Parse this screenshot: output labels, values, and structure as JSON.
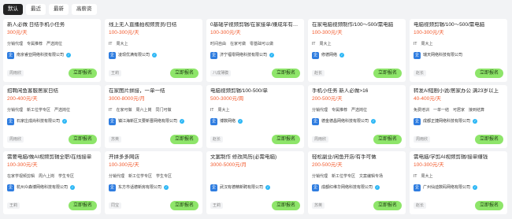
{
  "tabs": [
    "默认",
    "最近",
    "最新",
    "高薪资"
  ],
  "active_tab": 0,
  "apply_label": "立即报名",
  "cards": [
    {
      "title": "新人必做 日结手机小任务",
      "salary": "300元/天",
      "tags": [
        "分销代理",
        "专属推荐",
        "严选岗位"
      ],
      "company": "南京睿亚网络科技有限公司",
      "verified": true,
      "recruiter": "周雨欣"
    },
    {
      "title": "线上无人直播拍视频贾员/日结",
      "salary": "100-300元/天",
      "tags": [
        "IT",
        "周大上"
      ],
      "company": "凌现优满有限公司",
      "verified": true,
      "recruiter": "王莉"
    },
    {
      "title": "0基础学视频剪辑/在家接单/赚成年有电脑",
      "salary": "100-300元/天",
      "tags": [
        "时间自由",
        "在家可做",
        "零基础可以做"
      ],
      "company": "济宁福零网络科技有限公司",
      "verified": true,
      "recruiter": "八成薄膜"
    },
    {
      "title": "在家电脑视频制作/100～500/需电脑",
      "salary": "100-300元/天",
      "tags": [
        "IT",
        "周大上"
      ],
      "company": "修德网络",
      "verified": true,
      "recruiter": "赵长"
    },
    {
      "title": "电脑视频剪辑/100～500/需电脑",
      "salary": "100-300元/天",
      "tags": [
        "IT",
        "周大上"
      ],
      "company": "瑞天网络科技有限公司",
      "verified": false,
      "recruiter": "赵长"
    },
    {
      "title": "招聘闲鱼客服居家日结",
      "salary": "200-400元/天",
      "tags": [
        "分销代理",
        "新工位学专区",
        "严选岗位"
      ],
      "company": "石家庄成尚科技有限公司",
      "verified": true,
      "recruiter": "周雨欣"
    },
    {
      "title": "在家图片拼接，一单一结",
      "salary": "3000-8000元/月",
      "tags": [
        "IT",
        "在家可做",
        "周六上岗",
        "同门可做"
      ],
      "company": "镇江海新区又要新晋网络有限公司",
      "verified": true,
      "recruiter": "苏英"
    },
    {
      "title": "电脑视频剪辑/100-500/单",
      "salary": "500-3000元/周",
      "tags": [
        "IT",
        "周大上"
      ],
      "company": "博数网络",
      "verified": true,
      "recruiter": "赵长"
    },
    {
      "title": "手机小任务 新人必做>16",
      "salary": "200-500元/天",
      "tags": [
        "分销代理",
        "专属推荐",
        "严选岗位"
      ],
      "company": "德金德昌网络科技有限公司",
      "verified": true,
      "recruiter": "周雨欣"
    },
    {
      "title": "转发AI短剧小说/居家办公 满23岁以上",
      "salary": "40-400元/天",
      "tags": [
        "免费培训",
        "一单一结",
        "可居家",
        "接到结算"
      ],
      "company": "成都正捷网络科技有限公司",
      "verified": true,
      "recruiter": "周雨欣"
    },
    {
      "title": "需要电脑/做AI视频剪辑全职/在线接单",
      "salary": "100-300元/天",
      "tags": [
        "在家学视频剪辑",
        "周六上岗",
        "学生专区"
      ],
      "company": "杭州众森博网络科技有限公司",
      "verified": true,
      "recruiter": "王莉"
    },
    {
      "title": "开拼多多网店",
      "salary": "100-300元/天",
      "tags": [
        "分销代理",
        "新工位学专区",
        "学生专区"
      ],
      "company": "东方市话德新房有限公司",
      "verified": true,
      "recruiter": "同宝"
    },
    {
      "title": "文案制作 修改简历(必需电脑)",
      "salary": "3000-5000元/月",
      "tags": [],
      "company": "武汉有德精新聘有限公司",
      "verified": true,
      "recruiter": "王莉"
    },
    {
      "title": "轻松副业/闲鱼开店/有手可做",
      "salary": "200-500元/天",
      "tags": [
        "分销代理",
        "新工位学专区",
        "文案编辑专场"
      ],
      "company": "成都红维华网络科技有限公司",
      "verified": true,
      "recruiter": "苏英"
    },
    {
      "title": "需电脑/学剪AI视频剪辑/接单赚钱",
      "salary": "100-300元/天",
      "tags": [
        "IT",
        "周大上"
      ],
      "company": "广州仙迪数码网络有限公司",
      "verified": true,
      "recruiter": "赵长"
    }
  ]
}
